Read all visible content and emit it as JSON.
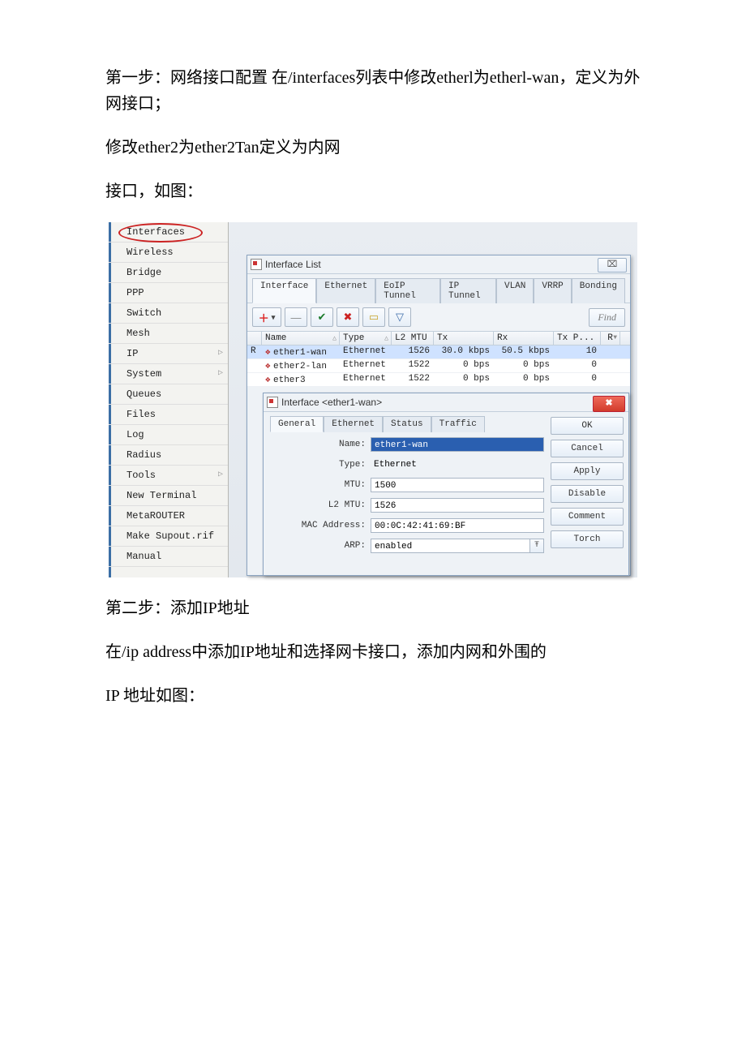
{
  "doc": {
    "p1": "第一步：网络接口配置 在/interfaces列表中修改etherl为etherl-wan，定义为外网接口；",
    "p2": "修改ether2为ether2Tan定义为内网",
    "p3": "接口，如图：",
    "p4": "第二步：添加IP地址",
    "p5": "在/ip address中添加IP地址和选择网卡接口，添加内网和外围的",
    "p6": "IP 地址如图："
  },
  "sidebar": {
    "items": [
      "Interfaces",
      "Wireless",
      "Bridge",
      "PPP",
      "Switch",
      "Mesh",
      "IP",
      "System",
      "Queues",
      "Files",
      "Log",
      "Radius",
      "Tools",
      "New Terminal",
      "MetaROUTER",
      "Make Supout.rif",
      "Manual"
    ],
    "submenu_indices": [
      6,
      7,
      12
    ]
  },
  "list_window": {
    "title": "Interface List",
    "close": "⌧",
    "tabs": [
      "Interface",
      "Ethernet",
      "EoIP Tunnel",
      "IP Tunnel",
      "VLAN",
      "VRRP",
      "Bonding"
    ],
    "toolbar": {
      "add": "＋",
      "minus": "—",
      "check": "✔",
      "x": "✖",
      "note": "▭",
      "filter": "▽"
    },
    "find": "Find",
    "columns": [
      "",
      "Name",
      "Type",
      "L2 MTU",
      "Tx",
      "Rx",
      "Tx P...",
      "R"
    ],
    "rows": [
      {
        "flag": "R",
        "name": "ether1-wan",
        "type": "Ethernet",
        "l2": "1526",
        "tx": "30.0 kbps",
        "rx": "50.5 kbps",
        "txp": "10",
        "sel": true
      },
      {
        "flag": "",
        "name": "ether2-lan",
        "type": "Ethernet",
        "l2": "1522",
        "tx": "0 bps",
        "rx": "0 bps",
        "txp": "0",
        "sel": false
      },
      {
        "flag": "",
        "name": "ether3",
        "type": "Ethernet",
        "l2": "1522",
        "tx": "0 bps",
        "rx": "0 bps",
        "txp": "0",
        "sel": false
      }
    ]
  },
  "detail_window": {
    "title": "Interface <ether1-wan>",
    "close": "✖",
    "tabs": [
      "General",
      "Ethernet",
      "Status",
      "Traffic"
    ],
    "fields": {
      "name_label": "Name:",
      "name": "ether1-wan",
      "type_label": "Type:",
      "type": "Ethernet",
      "mtu_label": "MTU:",
      "mtu": "1500",
      "l2_label": "L2 MTU:",
      "l2": "1526",
      "mac_label": "MAC Address:",
      "mac": "00:0C:42:41:69:BF",
      "arp_label": "ARP:",
      "arp": "enabled"
    },
    "buttons": [
      "OK",
      "Cancel",
      "Apply",
      "Disable",
      "Comment",
      "Torch"
    ]
  }
}
